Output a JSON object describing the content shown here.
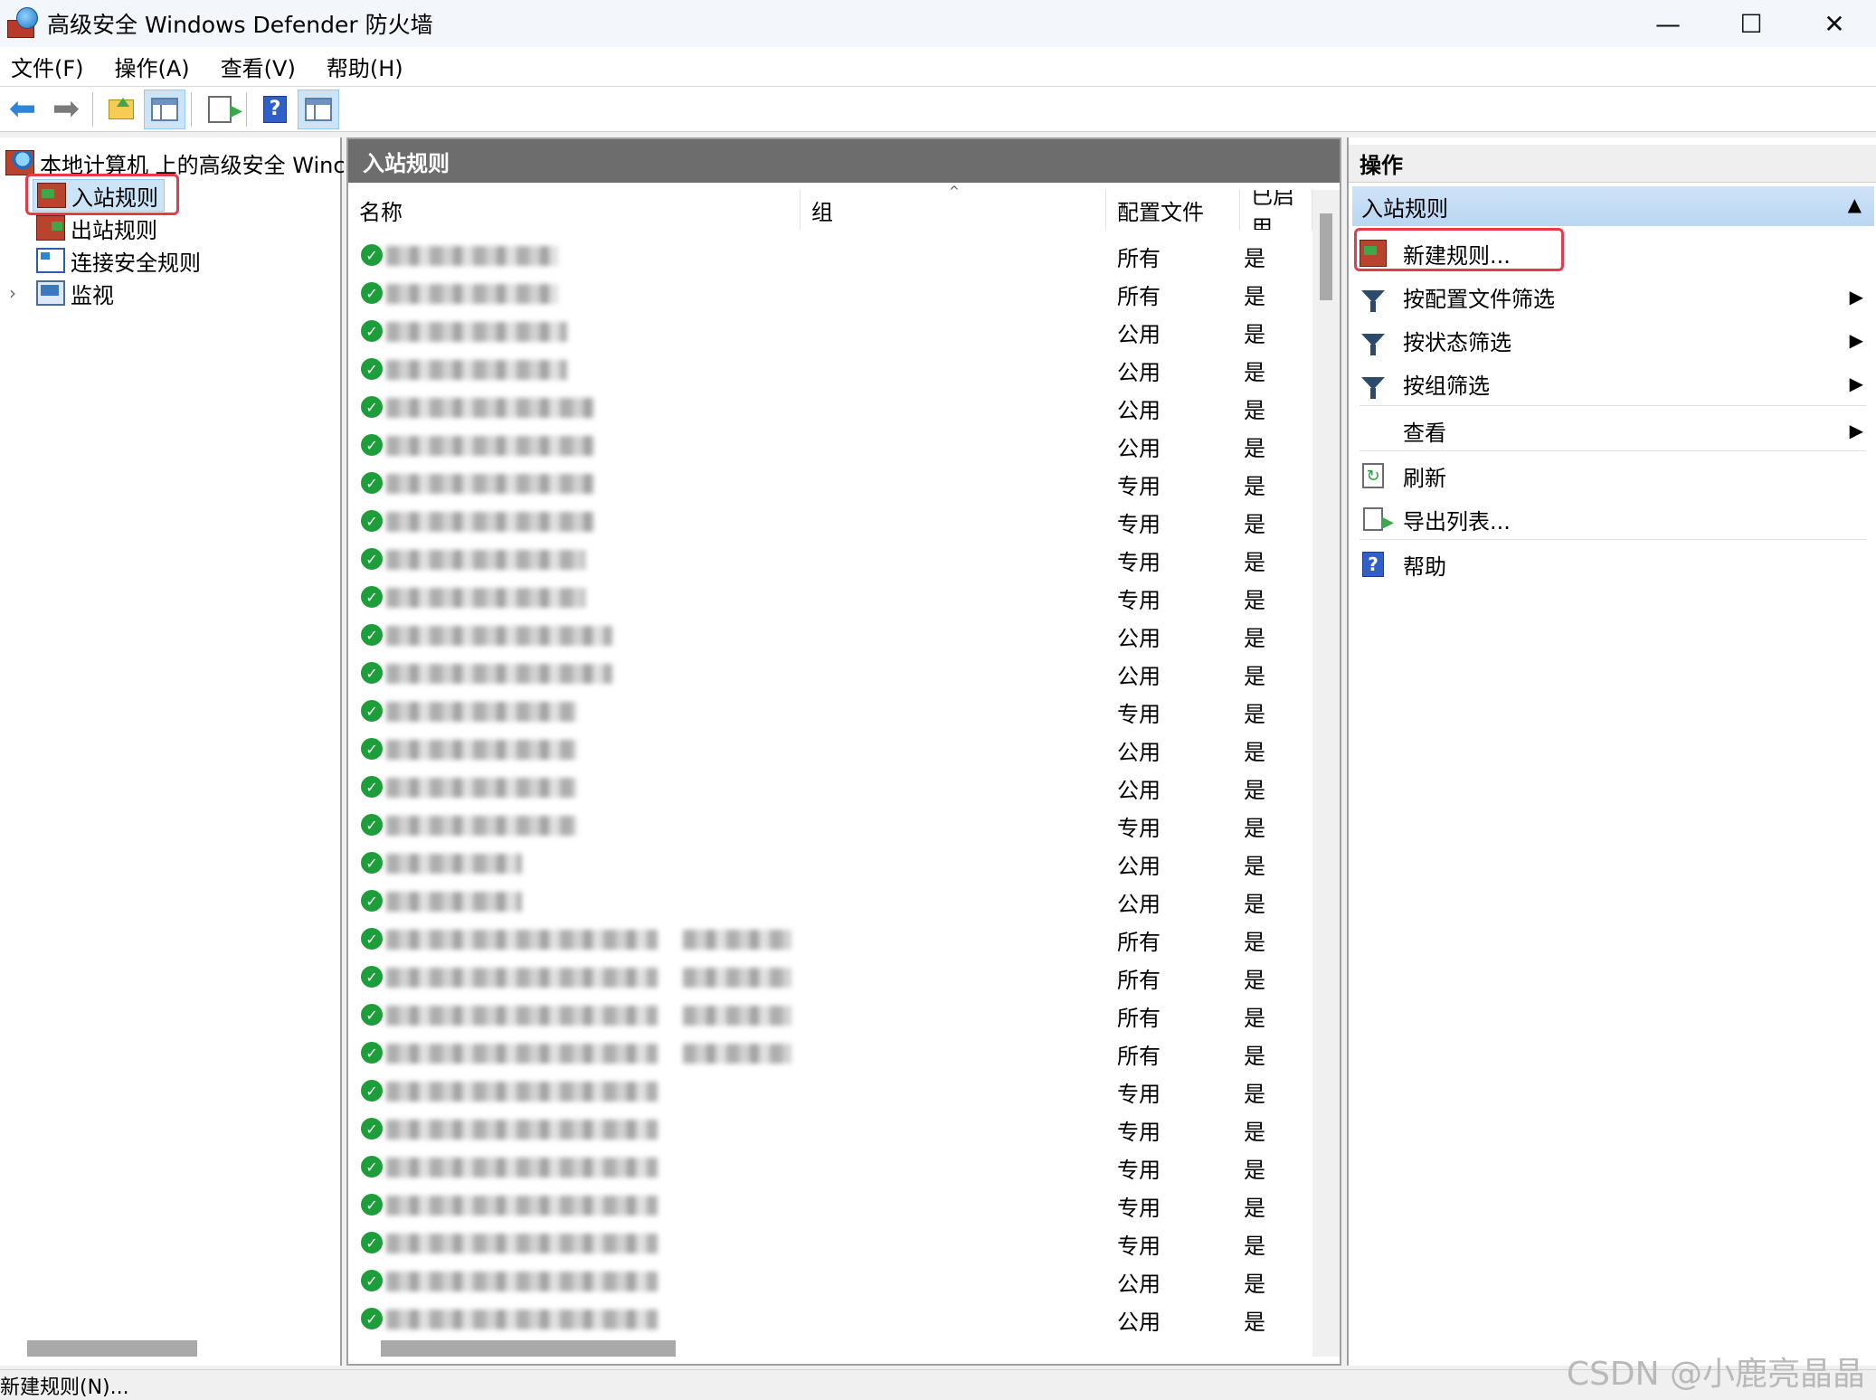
{
  "window": {
    "title": "高级安全 Windows Defender 防火墙",
    "controls": [
      "—",
      "☐",
      "✕"
    ]
  },
  "menu": [
    "文件(F)",
    "操作(A)",
    "查看(V)",
    "帮助(H)"
  ],
  "toolbar": {
    "icons": [
      "back-arrow-icon",
      "forward-arrow-icon",
      "up-folder-icon",
      "show-hide-tree-icon",
      "export-list-icon",
      "help-icon",
      "show-hide-action-pane-icon"
    ]
  },
  "tree": {
    "root": "本地计算机 上的高级安全 Winc",
    "items": [
      {
        "label": "入站规则",
        "selected": true
      },
      {
        "label": "出站规则"
      },
      {
        "label": "连接安全规则"
      },
      {
        "label": "监视",
        "expandable": true
      }
    ]
  },
  "middle": {
    "header": "入站规则",
    "columns": [
      "名称",
      "组",
      "配置文件",
      "已启用"
    ],
    "rows": [
      {
        "profile": "所有",
        "enabled": "是"
      },
      {
        "profile": "所有",
        "enabled": "是"
      },
      {
        "profile": "公用",
        "enabled": "是"
      },
      {
        "profile": "公用",
        "enabled": "是"
      },
      {
        "profile": "公用",
        "enabled": "是"
      },
      {
        "profile": "公用",
        "enabled": "是"
      },
      {
        "profile": "专用",
        "enabled": "是"
      },
      {
        "profile": "专用",
        "enabled": "是"
      },
      {
        "profile": "专用",
        "enabled": "是"
      },
      {
        "profile": "专用",
        "enabled": "是"
      },
      {
        "profile": "公用",
        "enabled": "是"
      },
      {
        "profile": "公用",
        "enabled": "是"
      },
      {
        "profile": "专用",
        "enabled": "是"
      },
      {
        "profile": "公用",
        "enabled": "是"
      },
      {
        "profile": "公用",
        "enabled": "是"
      },
      {
        "profile": "专用",
        "enabled": "是"
      },
      {
        "profile": "公用",
        "enabled": "是"
      },
      {
        "profile": "公用",
        "enabled": "是"
      },
      {
        "profile": "所有",
        "enabled": "是"
      },
      {
        "profile": "所有",
        "enabled": "是"
      },
      {
        "profile": "所有",
        "enabled": "是"
      },
      {
        "profile": "所有",
        "enabled": "是"
      },
      {
        "profile": "专用",
        "enabled": "是"
      },
      {
        "profile": "专用",
        "enabled": "是"
      },
      {
        "profile": "专用",
        "enabled": "是"
      },
      {
        "profile": "专用",
        "enabled": "是"
      },
      {
        "profile": "专用",
        "enabled": "是"
      },
      {
        "profile": "公用",
        "enabled": "是"
      },
      {
        "profile": "公用",
        "enabled": "是"
      }
    ]
  },
  "actions": {
    "header": "操作",
    "section": "入站规则",
    "items": [
      {
        "label": "新建规则...",
        "icon": "new-rule-icon"
      },
      {
        "label": "按配置文件筛选",
        "icon": "filter-icon",
        "submenu": true
      },
      {
        "label": "按状态筛选",
        "icon": "filter-icon",
        "submenu": true
      },
      {
        "label": "按组筛选",
        "icon": "filter-icon",
        "submenu": true
      },
      {
        "label": "查看",
        "submenu": true
      },
      {
        "label": "刷新",
        "icon": "refresh-icon"
      },
      {
        "label": "导出列表...",
        "icon": "export-list-icon"
      },
      {
        "label": "帮助",
        "icon": "help-icon"
      }
    ]
  },
  "statusbar": {
    "text": "新建规则(N)..."
  },
  "watermark": "CSDN @小鹿亮晶晶",
  "colors": {
    "highlight_red": "#e8394d",
    "selection_blue": "#cce4f7",
    "pane_header_gray": "#6d6d6d",
    "enabled_check_green": "#1e9e3a"
  }
}
